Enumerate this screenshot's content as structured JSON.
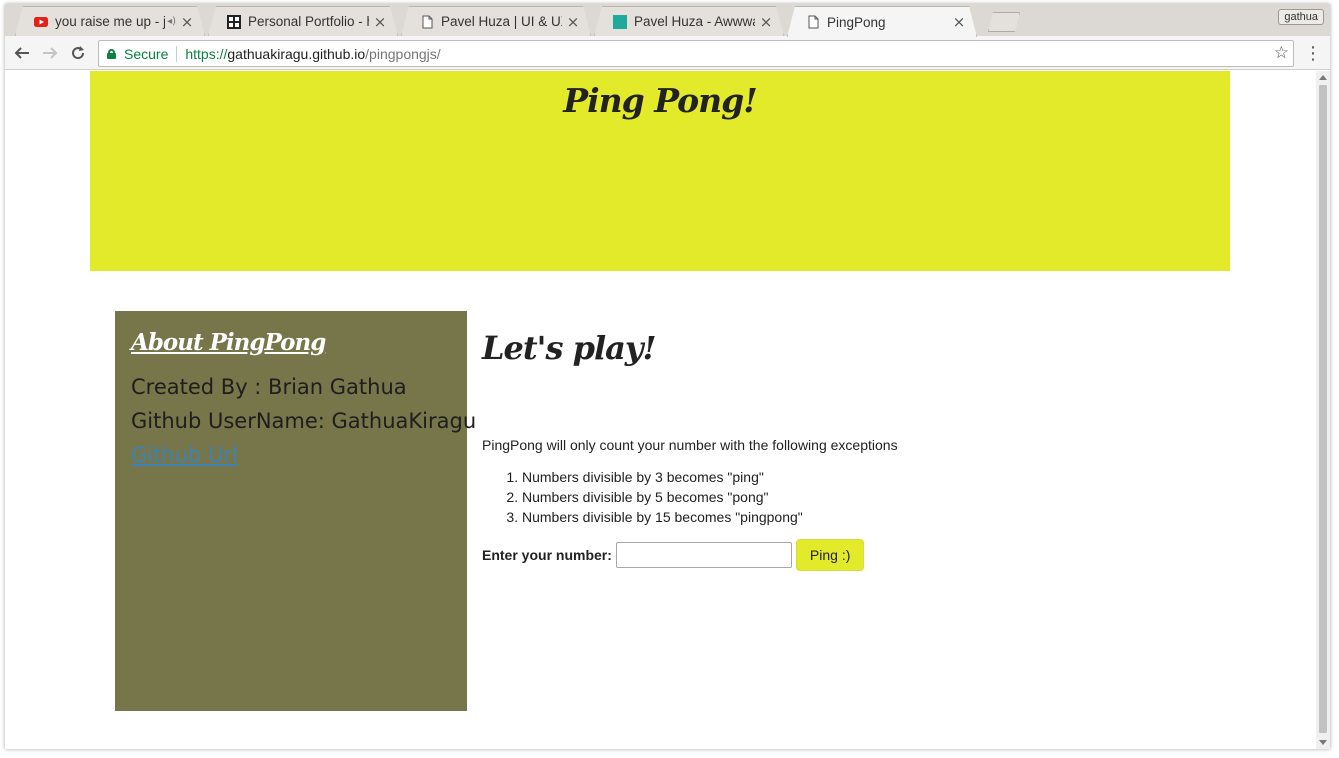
{
  "browser": {
    "tabs": [
      {
        "title": "you raise me up - jo",
        "icon": "youtube-icon",
        "speaker": "◂)",
        "active": false
      },
      {
        "title": "Personal Portfolio - h",
        "icon": "portfolio-grid-icon",
        "active": false
      },
      {
        "title": "Pavel Huza | UI & UX",
        "icon": "document-icon",
        "active": false
      },
      {
        "title": "Pavel Huza - Awwwar",
        "icon": "teal-square-icon",
        "active": false
      },
      {
        "title": "PingPong",
        "icon": "document-icon",
        "active": true
      }
    ],
    "profile_name": "gathua",
    "secure_label": "Secure",
    "url": {
      "scheme": "https://",
      "host": "gathuakiragu.github.io",
      "path": "/pingpongjs/"
    },
    "colors": {
      "secure_green": "#0b8043",
      "tabstrip": "#dcd8d3"
    }
  },
  "page": {
    "hero": {
      "title": "Ping Pong!",
      "color": "#e2ea29"
    },
    "about": {
      "title": "About PingPong",
      "created_by": "Created By : Brian Gathua",
      "github_username": "Github UserName: GathuaKiragu",
      "github_link": "Github Url",
      "color": "#77764a"
    },
    "main": {
      "title": "Let's play!",
      "intro": "PingPong will only count your number with the following exceptions",
      "rules": [
        "Numbers divisible by 3 becomes \"ping\"",
        "Numbers divisible by 5 becomes \"pong\"",
        "Numbers divisible by 15 becomes \"pingpong\""
      ],
      "input_label": "Enter your number:",
      "input_value": "",
      "button_label": "Ping :)"
    }
  }
}
